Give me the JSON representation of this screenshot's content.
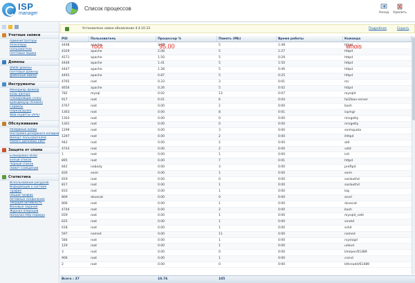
{
  "app": {
    "logo_name": "ISP",
    "logo_sub": "manager",
    "page_title": "Список процессов"
  },
  "toolbar": {
    "kill_label": "Назад",
    "delete_label": "Удалить"
  },
  "sidebar": {
    "sections": [
      {
        "title": "Учетные записи",
        "color": "#d9822b",
        "items": [
          "Администраторы",
          "Резеллеры",
          "Пользователи",
          "Почтовые ящики"
        ]
      },
      {
        "title": "Домены",
        "color": "#3a7cc0",
        "items": [
          "WWW домены",
          "Почтовые домены",
          "Доменные имена"
        ]
      },
      {
        "title": "Инструменты",
        "color": "#4a8ac4",
        "items": [
          "Менеджер файлов",
          "Базы данных",
          "Планировщик (cron)",
          "Брандмауэр (firewall)",
          "Сервисы",
          "Перезагрузка",
          "Web-скрипты (APS)"
        ]
      },
      {
        "title": "Обслуживание",
        "color": "#c77d2a",
        "items": [
          "Резервные копии",
          "Настройка резервного копирования",
          "Импорт пользователей",
          "Ремонт дисковых квот"
        ]
      },
      {
        "title": "Защита от спама",
        "color": "#d0502a",
        "items": [
          "Блокировка dnsbl",
          "Белый список",
          "Черный список",
          "Лимит сообщений"
        ]
      },
      {
        "title": "Статистика",
        "color": "#5a9a3a",
        "items": [
          "Использование ресурсов",
          "Информация о системе",
          "Трафик",
          "Общий трафик",
          "Активные соединения",
          "Текущая активность",
          "Фоновые задания",
          "Журнал операций",
          "Нагрузка http-сервера"
        ]
      }
    ]
  },
  "notice": {
    "text": "Установлено новое обновление 4.4.10.33",
    "link_details": "Подробнее",
    "link_hide": "Скрыть"
  },
  "table": {
    "columns": [
      "PID",
      "Пользователь",
      "Процессор %",
      "Память (Mb)",
      "Время работы",
      "Команда"
    ],
    "filter": {
      "user": "root",
      "cpu": "95.00",
      "cmd": "whois"
    },
    "rows": [
      [
        "4448",
        "apache",
        "3.00",
        "5",
        "1:48",
        "httpd"
      ],
      [
        "4329",
        "apache",
        "2.08",
        "5",
        "1:27",
        "httpd"
      ],
      [
        "4571",
        "apache",
        "1.50",
        "5",
        "0:29",
        "httpd"
      ],
      [
        "4446",
        "apache",
        "1.41",
        "5",
        "1:50",
        "httpd"
      ],
      [
        "4447",
        "apache",
        "1.28",
        "5",
        "0:46",
        "httpd"
      ],
      [
        "4491",
        "apache",
        "0.87",
        "5",
        "0:25",
        "httpd"
      ],
      [
        "4765",
        "root",
        "0.33",
        "3",
        "0:01",
        "mc"
      ],
      [
        "4656",
        "apache",
        "0.26",
        "5",
        "0:02",
        "httpd"
      ],
      [
        "782",
        "mysql",
        "0.02",
        "13",
        "0:07",
        "mysqld"
      ],
      [
        "917",
        "root",
        "0.01",
        "6",
        "0:04",
        "fail2ban-server"
      ],
      [
        "4767",
        "root",
        "0.00",
        "2",
        "0:00",
        "bash"
      ],
      [
        "1363",
        "root",
        "0.00",
        "8",
        "0:01",
        "ispmgr"
      ],
      [
        "1303",
        "root",
        "0.00",
        "0",
        "0:00",
        "mingetty"
      ],
      [
        "1301",
        "root",
        "0.00",
        "0",
        "0:00",
        "mingetty"
      ],
      [
        "1299",
        "root",
        "0.00",
        "3",
        "0:00",
        "eximquota"
      ],
      [
        "1297",
        "root",
        "0.00",
        "2",
        "0:00",
        "ihttpd"
      ],
      [
        "942",
        "root",
        "0.00",
        "2",
        "0:00",
        "atd"
      ],
      [
        "4743",
        "root",
        "0.00",
        "2",
        "0:00",
        "vztd"
      ],
      [
        "1",
        "root",
        "0.00",
        "1",
        "0:00",
        "init"
      ],
      [
        "895",
        "root",
        "0.00",
        "7",
        "0:01",
        "httpd"
      ],
      [
        "842",
        "nobody",
        "0.00",
        "3",
        "0:00",
        "proftpd"
      ],
      [
        "830",
        "exim",
        "0.00",
        "1",
        "0:00",
        "exim"
      ],
      [
        "819",
        "root",
        "0.00",
        "0",
        "0:00",
        "saslauthd"
      ],
      [
        "817",
        "root",
        "0.00",
        "1",
        "0:00",
        "saslauthd"
      ],
      [
        "810",
        "root",
        "0.00",
        "1",
        "0:00",
        "log"
      ],
      [
        "809",
        "dovecot",
        "0.00",
        "0",
        "0:00",
        "anvil"
      ],
      [
        "806",
        "root",
        "0.00",
        "1",
        "0:00",
        "dovecot"
      ],
      [
        "4744",
        "root",
        "0.00",
        "2",
        "0:00",
        "bash"
      ],
      [
        "659",
        "root",
        "0.00",
        "1",
        "0:00",
        "mysqld_safe"
      ],
      [
        "625",
        "root",
        "0.00",
        "1",
        "0:00",
        "xinetd"
      ],
      [
        "618",
        "root",
        "0.00",
        "1",
        "0:00",
        "sshd"
      ],
      [
        "597",
        "named",
        "0.00",
        "11",
        "0:00",
        "named"
      ],
      [
        "584",
        "root",
        "0.00",
        "1",
        "0:00",
        "rsyslogd"
      ],
      [
        "129",
        "root",
        "0.00",
        "1",
        "0:00",
        "udevd"
      ],
      [
        "3",
        "root",
        "0.00",
        "0",
        "0:00",
        "khelper/61489"
      ],
      [
        "906",
        "root",
        "0.00",
        "1",
        "0:00",
        "crond"
      ],
      [
        "2",
        "root",
        "0.00",
        "0",
        "0:00",
        "kthreadd/61489"
      ]
    ],
    "footer": {
      "label": "Всего : 37",
      "cpu_total": "10.76",
      "mem_total": "105"
    }
  }
}
